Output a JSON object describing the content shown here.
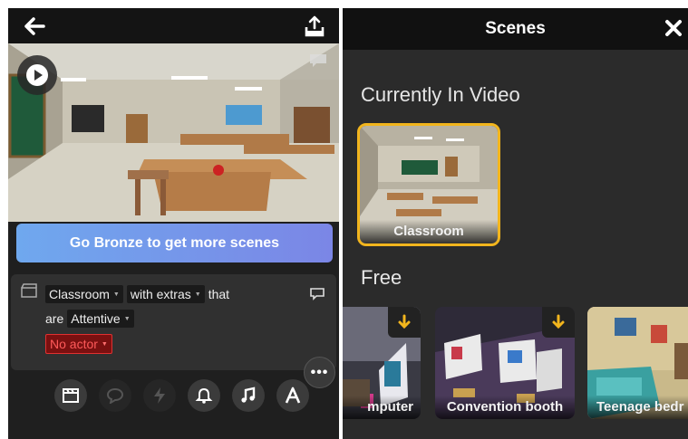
{
  "editor": {
    "back_icon": "arrow-left-icon",
    "share_icon": "share-upload-icon",
    "play_icon": "play-icon",
    "upgrade_label": "Go Bronze to get more scenes",
    "scene_line": {
      "scene": "Classroom",
      "extras": "with extras",
      "that": "that",
      "are": "are",
      "mood": "Attentive",
      "actor": "No actor"
    },
    "more_label": "•••",
    "toolbar": [
      "clapper-icon",
      "speech-bubble-icon",
      "lightning-icon",
      "bell-icon",
      "music-note-icon",
      "text-a-icon"
    ]
  },
  "scenes_panel": {
    "title": "Scenes",
    "close_icon": "close-x-icon",
    "current_heading": "Currently In Video",
    "current": [
      {
        "label": "Classroom"
      }
    ],
    "free_heading": "Free",
    "free": [
      {
        "label": "mputer"
      },
      {
        "label": "Convention booth"
      },
      {
        "label": "Teenage bedr"
      }
    ]
  },
  "colors": {
    "accent_selected": "#f2b51d",
    "alert_red": "#e03030",
    "upgrade_gradient_start": "#6fa8ee",
    "upgrade_gradient_end": "#7b86e6",
    "download_arrow": "#f2b51d"
  }
}
